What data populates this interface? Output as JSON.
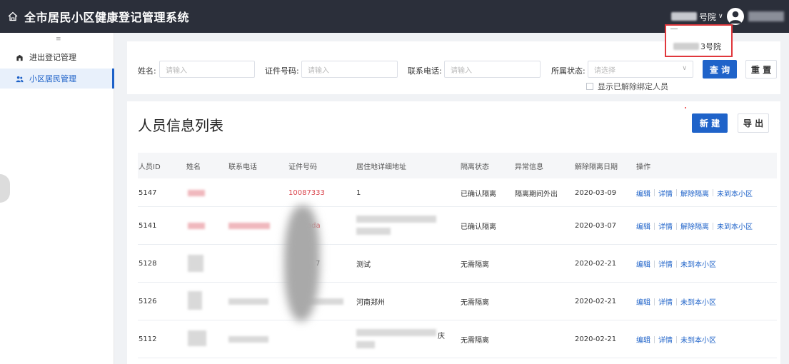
{
  "app": {
    "title": "全市居民小区健康登记管理系统"
  },
  "header": {
    "org_suffix": "号院",
    "org_caret": "∨",
    "org_option_suffix": "3号院"
  },
  "sidebar": {
    "collapse_glyph": "≡",
    "items": [
      {
        "label": "进出登记管理",
        "icon": "building-icon",
        "active": false
      },
      {
        "label": "小区居民管理",
        "icon": "users-icon",
        "active": true
      }
    ]
  },
  "search": {
    "name_label": "姓名:",
    "name_placeholder": "请输入",
    "id_label": "证件号码:",
    "id_placeholder": "请输入",
    "phone_label": "联系电话:",
    "phone_placeholder": "请输入",
    "status_label": "所属状态:",
    "status_placeholder": "请选择",
    "status_caret": "∨",
    "show_unbound_label": "显示已解除绑定人员",
    "query_label": "查 询",
    "reset_label": "重 置"
  },
  "list": {
    "title": "人员信息列表",
    "new_label": "新 建",
    "export_label": "导 出",
    "columns": [
      "人员ID",
      "姓名",
      "联系电话",
      "证件号码",
      "居住地详细地址",
      "隔离状态",
      "异常信息",
      "解除隔离日期",
      "操作"
    ],
    "rows": [
      {
        "id": "5147",
        "id_number": "10087333",
        "address": "1",
        "status": "已确认隔离",
        "anomaly": "隔离期间外出",
        "date": "2020-03-09",
        "actions": [
          "编辑",
          "详情",
          "解除隔离",
          "未到本小区"
        ]
      },
      {
        "id": "5141",
        "id_number": "ada",
        "address": "",
        "status": "已确认隔离",
        "anomaly": "",
        "date": "2020-03-07",
        "actions": [
          "编辑",
          "详情",
          "解除隔离",
          "未到本小区"
        ]
      },
      {
        "id": "5128",
        "id_number": "7",
        "address": "测试",
        "status": "无需隔离",
        "anomaly": "",
        "date": "2020-02-21",
        "actions": [
          "编辑",
          "详情",
          "未到本小区"
        ]
      },
      {
        "id": "5126",
        "id_number": "",
        "address": "河南郑州",
        "status": "无需隔离",
        "anomaly": "",
        "date": "2020-02-21",
        "actions": [
          "编辑",
          "详情",
          "未到本小区"
        ]
      },
      {
        "id": "5112",
        "id_number": "",
        "address": "庆",
        "status": "无需隔离",
        "anomaly": "",
        "date": "2020-02-21",
        "actions": [
          "编辑",
          "详情",
          "未到本小区"
        ]
      }
    ]
  },
  "colors": {
    "topbar": "#2b2f3a",
    "primary": "#1f63c9",
    "link_red": "#d9434b",
    "highlight_border": "#e0373c"
  }
}
